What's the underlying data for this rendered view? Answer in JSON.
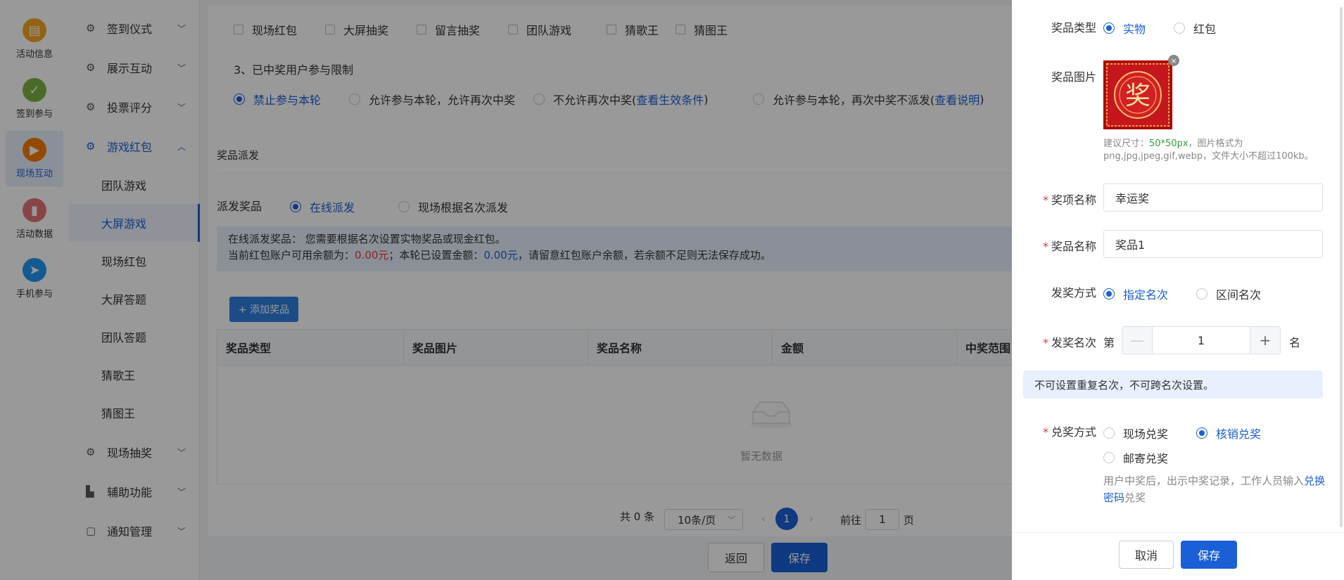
{
  "iconbar": [
    {
      "label": "活动信息",
      "icon": "id-card-icon",
      "color": "#f5a623"
    },
    {
      "label": "签到参与",
      "icon": "check-badge-icon",
      "color": "#7cb342"
    },
    {
      "label": "现场互动",
      "icon": "screen-play-icon",
      "color": "#f57c00"
    },
    {
      "label": "活动数据",
      "icon": "bar-chart-icon",
      "color": "#e57373"
    },
    {
      "label": "手机参与",
      "icon": "paper-plane-icon",
      "color": "#2196f3"
    }
  ],
  "menu": {
    "g1": "签到仪式",
    "g2": "展示互动",
    "g3": "投票评分",
    "g4": "游戏红包",
    "s1": "团队游戏",
    "s2": "大屏游戏",
    "s3": "现场红包",
    "s4": "大屏答题",
    "s5": "团队答题",
    "s6": "猜歌王",
    "s7": "猜图王",
    "g5": "现场抽奖",
    "g6": "辅助功能",
    "g7": "通知管理"
  },
  "games": [
    "现场红包",
    "大屏抽奖",
    "留言抽奖",
    "团队游戏",
    "猜歌王",
    "猜图王"
  ],
  "restrict": {
    "title": "3、已中奖用户参与限制",
    "o1": "禁止参与本轮",
    "o2": "允许参与本轮，允许再次中奖",
    "o3a": "不允许再次中奖(",
    "o3l": "查看生效条件",
    "o3b": ")",
    "o4a": "允许参与本轮，再次中奖不派发(",
    "o4l": "查看说明",
    "o4b": ")"
  },
  "dispatch": {
    "section": "奖品派发",
    "label": "派发奖品",
    "o1": "在线派发",
    "o2": "现场根据名次派发",
    "n1": "在线派发奖品：  您需要根据名次设置实物奖品或现金红包。",
    "n2a": "当前红包账户可用余额为：",
    "n2b": "0.00元",
    "n2c": "；本轮已设置金额：",
    "n2d": "0.00元",
    "n2e": "，请留意红包账户余额，若余额不足则无法保存成功。"
  },
  "add_label": "+ 添加奖品",
  "table": {
    "headers": [
      "奖品类型",
      "奖品图片",
      "奖品名称",
      "金额",
      "中奖范围"
    ],
    "empty": "暂无数据"
  },
  "pager": {
    "total": "共 0 条",
    "size": "10条/页",
    "page": "1",
    "goto": "前往",
    "goto_val": "1",
    "page_unit": "页"
  },
  "footer": {
    "back": "返回",
    "save": "保存"
  },
  "drawer": {
    "type_label": "奖品类型",
    "type_o1": "实物",
    "type_o2": "红包",
    "img_label": "奖品图片",
    "img_char": "奖",
    "hint_a": "建议尺寸：",
    "hint_b": "50*50px",
    "hint_c": "，图片格式为",
    "hint_d": "png,jpg,jpeg,gif,webp，文件大小不超过100kb。",
    "award_label": "奖项名称",
    "award_val": "幸运奖",
    "prize_label": "奖品名称",
    "prize_val": "奖品1",
    "method_label": "发奖方式",
    "method_o1": "指定名次",
    "method_o2": "区间名次",
    "rank_label": "发奖名次",
    "rank_pre": "第",
    "rank_val": "1",
    "rank_post": "名",
    "tip": "不可设置重复名次，不可跨名次设置。",
    "redeem_label": "兑奖方式",
    "redeem_o1": "现场兑奖",
    "redeem_o2": "核销兑奖",
    "redeem_o3": "邮寄兑奖",
    "redeem_hint_a": "用户中奖后，出示中奖记录，工作人员输入",
    "redeem_hint_l": "兑换密码",
    "redeem_hint_b": "兑奖",
    "cancel": "取消",
    "save": "保存"
  }
}
